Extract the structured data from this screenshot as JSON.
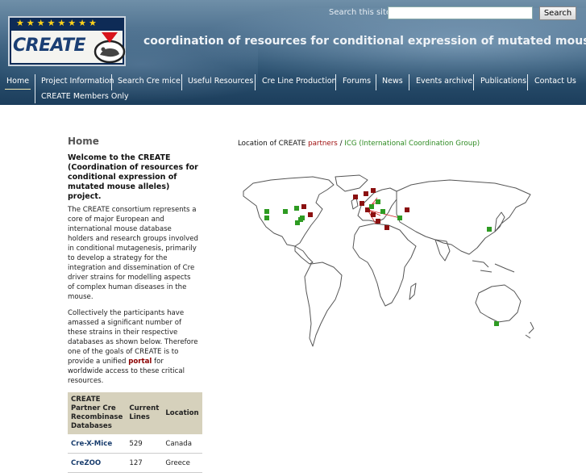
{
  "header": {
    "search_label": "Search this site:",
    "search_value": "",
    "search_button": "Search",
    "logo_text": "CREATE",
    "logo_stars": "★★★★★★★★",
    "site_title": "coordination of resources for conditional expression of mutated mouse alleles"
  },
  "nav": {
    "items": [
      "Home",
      "Project Information",
      "Search Cre mice",
      "Useful Resources",
      "Cre Line Production",
      "Forums",
      "News",
      "Events archive",
      "Publications",
      "Contact Us",
      "CREATE Members Only"
    ],
    "active": "Home"
  },
  "main": {
    "title": "Home",
    "welcome": "Welcome to the CREATE (Coordination of resources for conditional expression of mutated mouse alleles) project.",
    "para1": "The CREATE consortium represents a core of major European and international mouse database holders and research groups involved in conditional mutagenesis, primarily to develop a strategy for the integration and dissemination of Cre driver strains for modelling aspects of complex human diseases in the mouse.",
    "para2_before": "Collectively the participants have amassed a significant number of these strains in their respective databases as shown below. Therefore one of the goals of CREATE is to provide a unified",
    "para2_link": "portal",
    "para2_after": "for worldwide access to these critical resources.",
    "table": {
      "headers": [
        "CREATE Partner Cre Recombinase Databases",
        "Current Lines",
        "Location"
      ],
      "rows": [
        {
          "name": "Cre-X-Mice",
          "lines": "529",
          "location": "Canada"
        },
        {
          "name": "CreZOO",
          "lines": "127",
          "location": "Greece"
        }
      ]
    }
  },
  "map": {
    "caption_prefix": "Location of CREATE",
    "caption_partners": "partners",
    "caption_sep": "/",
    "caption_icg": "ICG (International Coordination Group)",
    "partner_color": "#8b1010",
    "icg_color": "#2e9b22"
  }
}
